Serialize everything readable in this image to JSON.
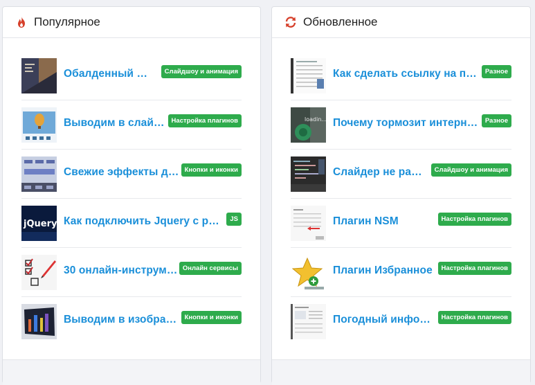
{
  "popular": {
    "title": "Популярное",
    "icon": "fire-icon",
    "accent": "#d6402b",
    "items": [
      {
        "title": "Обалденный пол...",
        "badge": "Слайдшоу и анимация",
        "thumb": "photo-thumbnail"
      },
      {
        "title": "Выводим в слайде...",
        "badge": "Настройка плагинов",
        "thumb": "balloon-slider-thumbnail"
      },
      {
        "title": "Свежие эффекты для...",
        "badge": "Кнопки и иконки",
        "thumb": "buttons-thumbnail"
      },
      {
        "title": "Как подключить Jquery с раз...",
        "badge": "JS",
        "thumb": "jquery-thumbnail"
      },
      {
        "title": "30 онлайн-инструме...",
        "badge": "Онлайн сервисы",
        "thumb": "checklist-thumbnail"
      },
      {
        "title": "Выводим в изображ...",
        "badge": "Кнопки и иконки",
        "thumb": "city-thumbnail"
      }
    ]
  },
  "updated": {
    "title": "Обновленное",
    "icon": "refresh-icon",
    "accent": "#d6402b",
    "items": [
      {
        "title": "Как сделать ссылку на про...",
        "badge": "Разное",
        "thumb": "table-screenshot-thumbnail"
      },
      {
        "title": "Почему тормозит интерне...",
        "badge": "Разное",
        "thumb": "loading-thumbnail"
      },
      {
        "title": "Слайдер не работ...",
        "badge": "Слайдшоу и анимация",
        "thumb": "code-screenshot-thumbnail"
      },
      {
        "title": "Плагин NSM",
        "badge": "Настройка плагинов",
        "thumb": "settings-screenshot-thumbnail"
      },
      {
        "title": "Плагин Избранное",
        "badge": "Настройка плагинов",
        "thumb": "star-thumbnail"
      },
      {
        "title": "Погодный информ...",
        "badge": "Настройка плагинов",
        "thumb": "page-screenshot-thumbnail"
      }
    ]
  },
  "colors": {
    "link": "#1a8fd9",
    "badge": "#2eab4c"
  }
}
